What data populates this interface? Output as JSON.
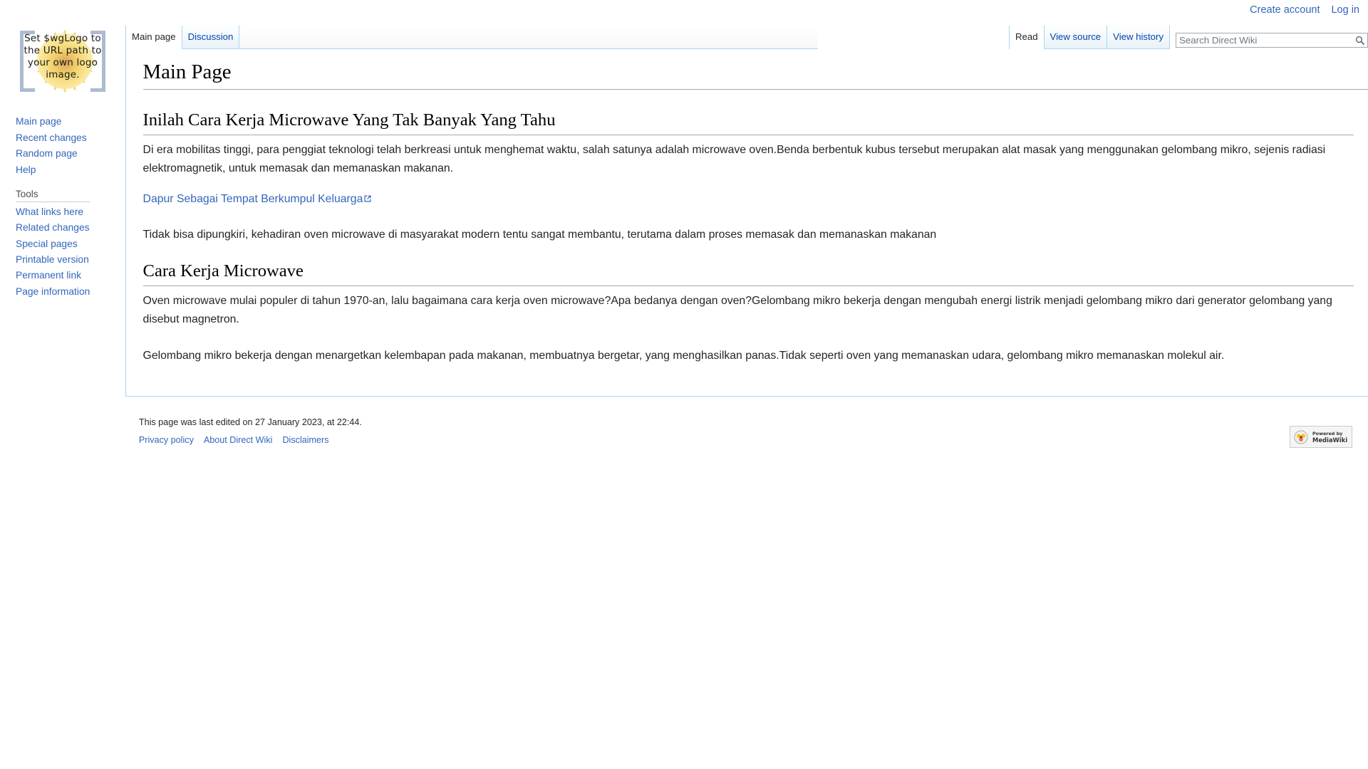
{
  "site": {
    "name": "Direct Wiki",
    "logo_text": "Set $wgLogo to the URL path to your own logo image."
  },
  "personal_tools": {
    "create_account": "Create account",
    "log_in": "Log in"
  },
  "namespace_tabs": [
    {
      "label": "Main page",
      "selected": true
    },
    {
      "label": "Discussion",
      "selected": false
    }
  ],
  "view_tabs": [
    {
      "label": "Read",
      "selected": true
    },
    {
      "label": "View source",
      "selected": false
    },
    {
      "label": "View history",
      "selected": false
    }
  ],
  "search": {
    "placeholder": "Search Direct Wiki",
    "value": "",
    "icon": "search-icon"
  },
  "sidebar": {
    "navigation": {
      "items": [
        {
          "label": "Main page"
        },
        {
          "label": "Recent changes"
        },
        {
          "label": "Random page"
        },
        {
          "label": "Help"
        }
      ]
    },
    "tools": {
      "heading": "Tools",
      "items": [
        {
          "label": "What links here"
        },
        {
          "label": "Related changes"
        },
        {
          "label": "Special pages"
        },
        {
          "label": "Printable version"
        },
        {
          "label": "Permanent link"
        },
        {
          "label": "Page information"
        }
      ]
    }
  },
  "content": {
    "title": "Main Page",
    "section1": {
      "heading": "Inilah Cara Kerja Microwave Yang Tak Banyak Yang Tahu",
      "paragraph1": "Di era mobilitas tinggi, para penggiat teknologi telah berkreasi untuk menghemat waktu, salah satunya adalah microwave oven.Benda berbentuk kubus tersebut merupakan alat masak yang menggunakan gelombang mikro, sejenis radiasi elektromagnetik, untuk memasak dan memanaskan makanan.",
      "link": "Dapur Sebagai Tempat Berkumpul Keluarga",
      "paragraph2": "Tidak bisa dipungkiri, kehadiran oven microwave di masyarakat modern tentu sangat membantu, terutama dalam proses memasak dan memanaskan makanan"
    },
    "section2": {
      "heading": "Cara Kerja Microwave",
      "paragraph1": "Oven microwave mulai populer di tahun 1970-an, lalu bagaimana cara kerja oven microwave?Apa bedanya dengan oven?Gelombang mikro bekerja dengan mengubah energi listrik menjadi gelombang mikro dari generator gelombang yang disebut magnetron.",
      "paragraph2": "Gelombang mikro bekerja dengan menargetkan kelembapan pada makanan, membuatnya bergetar, yang menghasilkan panas.Tidak seperti oven yang memanaskan udara, gelombang mikro memanaskan molekul air."
    }
  },
  "footer": {
    "last_edited": "This page was last edited on 27 January 2023, at 22:44.",
    "places": [
      {
        "label": "Privacy policy"
      },
      {
        "label": "About Direct Wiki"
      },
      {
        "label": "Disclaimers"
      }
    ],
    "powered_by": {
      "line1": "Powered by",
      "line2": "MediaWiki"
    }
  },
  "colors": {
    "link": "#3366bb",
    "tab_border": "#a7d7f9",
    "text": "#252525",
    "rule": "#a2a9b1"
  }
}
